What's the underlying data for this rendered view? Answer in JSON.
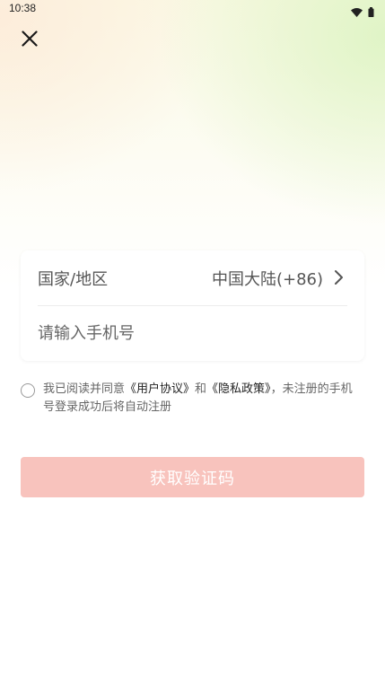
{
  "status_bar": {
    "time": "10:38"
  },
  "close_icon": "close-icon",
  "region_row": {
    "label": "国家/地区",
    "value": "中国大陆(+86)",
    "icon": "chevron-right-icon"
  },
  "phone_input": {
    "placeholder": "请输入手机号",
    "value": ""
  },
  "agreement": {
    "prefix": "我已阅读并同意",
    "user_agreement": "《用户协议》",
    "and": "和",
    "privacy_policy": "《隐私政策》",
    "suffix": "，未注册的手机号登录成功后将自动注册"
  },
  "submit_button": {
    "label": "获取验证码"
  },
  "colors": {
    "button_disabled": "#f8c3bd",
    "text_primary": "#222222",
    "text_secondary": "#666666"
  }
}
